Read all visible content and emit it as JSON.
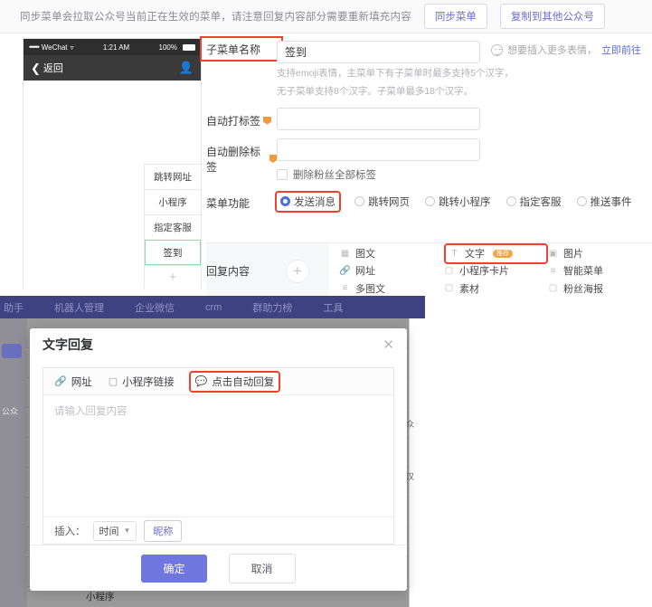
{
  "notice": {
    "text": "同步菜单会拉取公众号当前正在生效的菜单，请注意回复内容部分需要重新填充内容",
    "sync_button": "同步菜单",
    "copy_button": "复制到其他公众号"
  },
  "phone": {
    "carrier": "WeChat",
    "dots": "•••••",
    "wifi_icon": "wifi-icon",
    "time": "1:21 AM",
    "battery_percent": "100%",
    "back_label": "返回",
    "back_icon": "chevron-left-icon",
    "avatar_icon": "avatar-icon",
    "menu_items": [
      {
        "label": "跳转网址",
        "active": false
      },
      {
        "label": "小程序",
        "active": false
      },
      {
        "label": "指定客服",
        "active": false
      },
      {
        "label": "签到",
        "active": true
      }
    ],
    "add_label": "+"
  },
  "form": {
    "submenu_name_label": "子菜单名称",
    "submenu_name_value": "签到",
    "submenu_name_hint_line1": "支持emoji表情，主菜单下有子菜单时最多支持5个汉字，",
    "submenu_name_hint_line2": "无子菜单支持8个汉字。子菜单最多18个汉字。",
    "emoji_note": "想要插入更多表情，",
    "emoji_link": "立即前往",
    "auto_tag_label": "自动打标签",
    "auto_tag_value": "",
    "auto_tag_placeholder": "",
    "auto_del_tag_label": "自动删除标签",
    "auto_del_tag_value": "",
    "auto_del_tag_placeholder": "",
    "del_all_tags_label": "删除粉丝全部标签",
    "menu_func_label": "菜单功能",
    "menu_func_options": [
      {
        "label": "发送消息",
        "selected": true
      },
      {
        "label": "跳转网页",
        "selected": false
      },
      {
        "label": "跳转小程序",
        "selected": false
      },
      {
        "label": "指定客服",
        "selected": false
      },
      {
        "label": "推送事件",
        "selected": false
      }
    ]
  },
  "reply": {
    "label": "回复内容",
    "add_icon": "plus-icon",
    "options": [
      {
        "label": "图文",
        "icon": "article-icon",
        "badge": "",
        "highlight": false
      },
      {
        "label": "文字",
        "icon": "text-icon",
        "badge": "推荐",
        "highlight": true
      },
      {
        "label": "图片",
        "icon": "image-icon",
        "badge": "",
        "highlight": false
      },
      {
        "label": "网址",
        "icon": "link-icon",
        "badge": "",
        "highlight": false
      },
      {
        "label": "小程序卡片",
        "icon": "miniprogram-card-icon",
        "badge": "",
        "highlight": false
      },
      {
        "label": "智能菜单",
        "icon": "smart-menu-icon",
        "badge": "",
        "highlight": false
      },
      {
        "label": "多图文",
        "icon": "multi-article-icon",
        "badge": "",
        "highlight": false
      },
      {
        "label": "素材",
        "icon": "material-icon",
        "badge": "",
        "highlight": false
      },
      {
        "label": "粉丝海报",
        "icon": "poster-icon",
        "badge": "",
        "highlight": false
      }
    ]
  },
  "background": {
    "nav_items": [
      "助手",
      "机器人管理",
      "企业微信",
      "crm",
      "群助力榜",
      "工具"
    ],
    "fragment_top": "公众",
    "fragment_mid": "个汉",
    "fragment_radio": "推",
    "bottom_label": "小程序"
  },
  "modal": {
    "title": "文字回复",
    "close_icon": "close-icon",
    "toolbar": [
      {
        "label": "网址",
        "icon": "link-icon",
        "highlight": false
      },
      {
        "label": "小程序链接",
        "icon": "miniprogram-icon",
        "highlight": false
      },
      {
        "label": "点击自动回复",
        "icon": "auto-reply-icon",
        "highlight": true
      }
    ],
    "textarea_placeholder": "请输入回复内容",
    "textarea_value": "",
    "insert_label": "插入：",
    "insert_select_value": "时间",
    "insert_nickname_button": "昵称",
    "confirm_button": "确定",
    "cancel_button": "取消"
  },
  "colors": {
    "accent": "#6f76dd",
    "highlight": "#f0402f",
    "badge": "#f5a43c",
    "active_menu_border": "#9fd3a8",
    "nav_bg": "#3f4280"
  }
}
